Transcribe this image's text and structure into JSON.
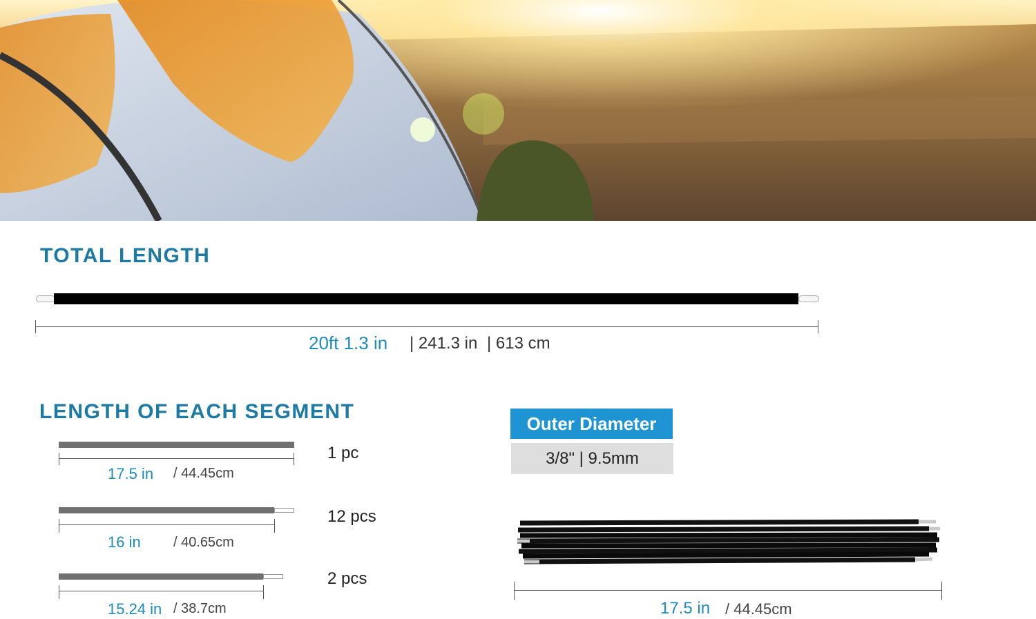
{
  "total_length": {
    "heading": "TOTAL LENGTH",
    "imperial": "20ft 1.3 in",
    "inches": "| 241.3 in",
    "metric": "| 613 cm"
  },
  "segments": {
    "heading": "LENGTH OF EACH SEGMENT",
    "items": [
      {
        "inches": "17.5 in",
        "cm": "/ 44.45cm",
        "qty": "1 pc"
      },
      {
        "inches": "16 in",
        "cm": "/ 40.65cm",
        "qty": "12 pcs"
      },
      {
        "inches": "15.24 in",
        "cm": "/ 38.7cm",
        "qty": "2 pcs"
      }
    ]
  },
  "outer_diameter": {
    "title": "Outer Diameter",
    "value": "3/8\" | 9.5mm"
  },
  "bundle": {
    "inches": "17.5 in",
    "cm": "/ 44.45cm"
  },
  "colors": {
    "heading": "#1b7aa6",
    "accent": "#1b8cc0",
    "badge": "#1e94d2",
    "badge_value_bg": "#dedede"
  }
}
